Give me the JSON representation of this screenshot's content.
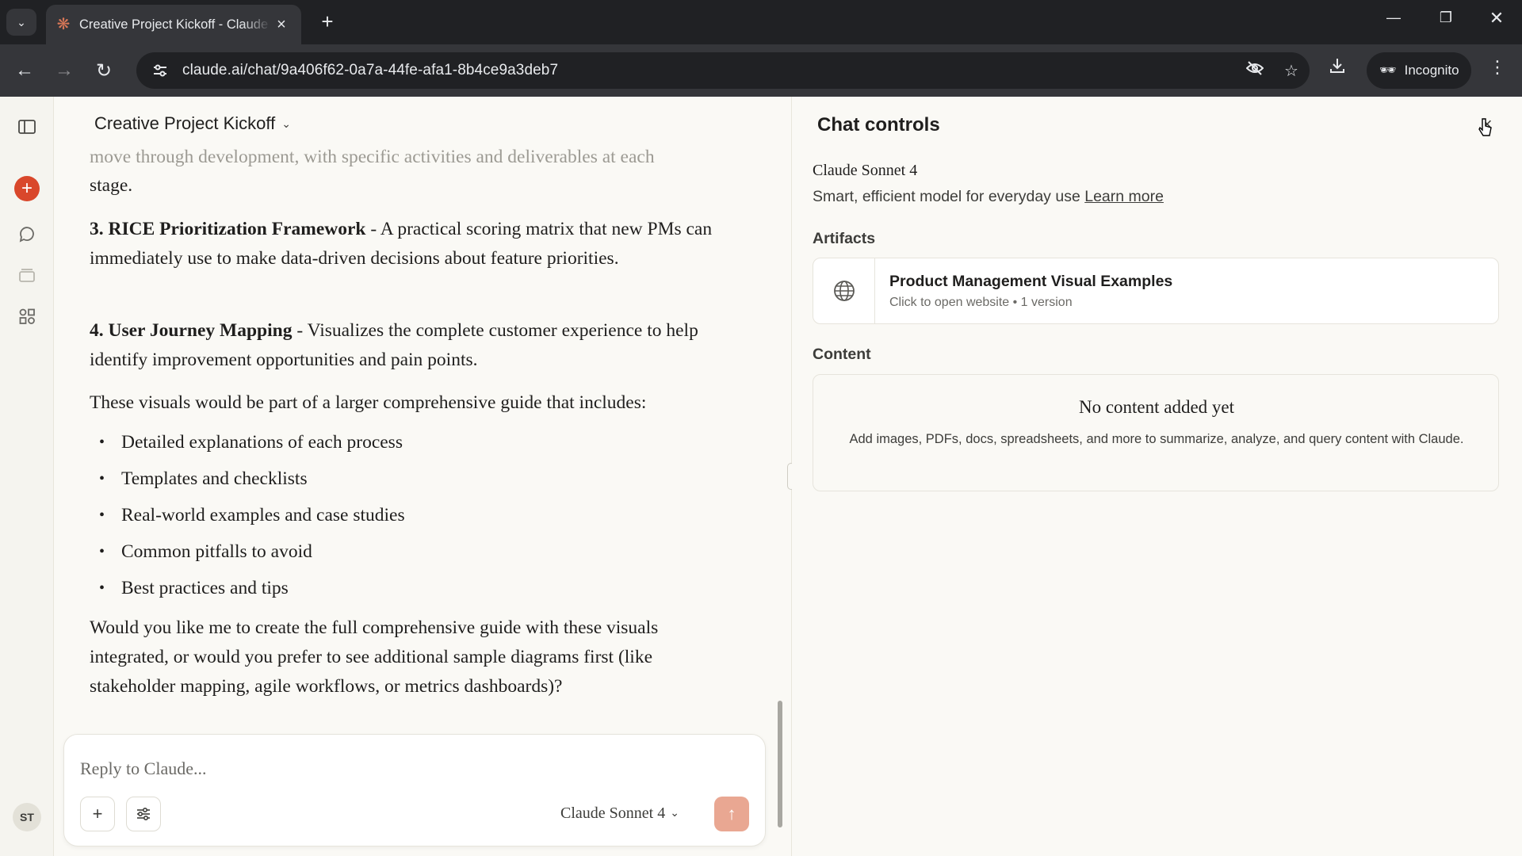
{
  "browser": {
    "tab_title": "Creative Project Kickoff - Claude",
    "url": "claude.ai/chat/9a406f62-0a7a-44fe-afa1-8b4ce9a3deb7",
    "incognito_label": "Incognito"
  },
  "chat": {
    "title": "Creative Project Kickoff",
    "faded_line": "move through development, with specific activities and deliverables at each",
    "faded_tail": "stage.",
    "item3_bold": "3. RICE Prioritization Framework",
    "item3_text": " - A practical scoring matrix that new PMs can immediately use to make data-driven decisions about feature priorities.",
    "item4_bold": "4. User Journey Mapping",
    "item4_text": " - Visualizes the complete customer experience to help identify improvement opportunities and pain points.",
    "intro": "These visuals would be part of a larger comprehensive guide that includes:",
    "bullets": [
      "Detailed explanations of each process",
      "Templates and checklists",
      "Real-world examples and case studies",
      "Common pitfalls to avoid",
      "Best practices and tips"
    ],
    "closing": "Would you like me to create the full comprehensive guide with these visuals integrated, or would you prefer to see additional sample diagrams first (like stakeholder mapping, agile workflows, or metrics dashboards)?",
    "input_placeholder": "Reply to Claude...",
    "model_selector": "Claude Sonnet 4"
  },
  "sidebar": {
    "avatar_initials": "ST"
  },
  "panel": {
    "title": "Chat controls",
    "model_name": "Claude Sonnet 4",
    "model_desc": "Smart, efficient model for everyday use ",
    "learn_more": "Learn more",
    "artifacts_label": "Artifacts",
    "artifact_title": "Product Management Visual Examples",
    "artifact_sub": "Click to open website • 1 version",
    "content_label": "Content",
    "no_content_title": "No content added yet",
    "no_content_desc": "Add images, PDFs, docs, spreadsheets, and more to summarize, analyze, and query content with Claude."
  },
  "colors": {
    "accent": "#d9472b",
    "send_button": "#e9a792",
    "background": "#faf9f5"
  }
}
